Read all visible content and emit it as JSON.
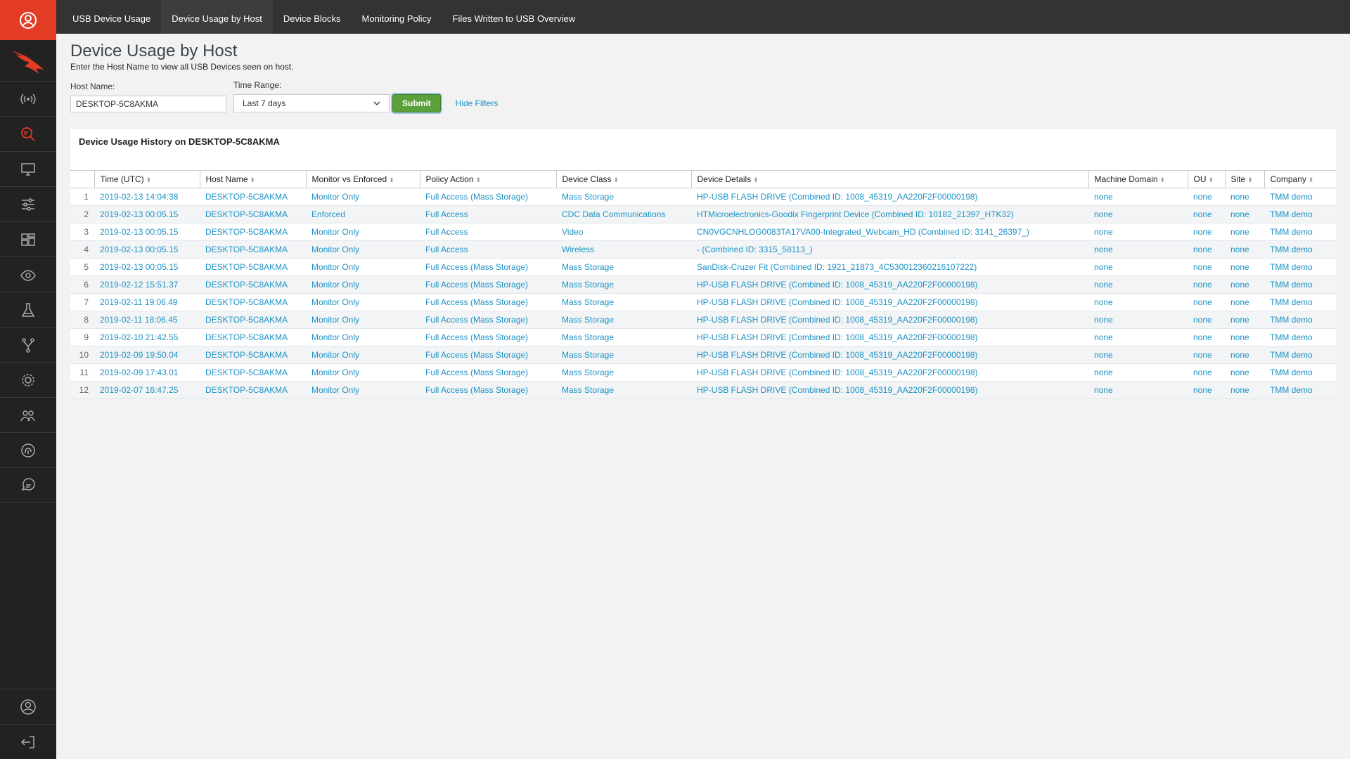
{
  "nav": {
    "tabs": [
      {
        "label": "USB Device Usage"
      },
      {
        "label": "Device Usage by Host"
      },
      {
        "label": "Device Blocks"
      },
      {
        "label": "Monitoring Policy"
      },
      {
        "label": "Files Written to USB Overview"
      }
    ],
    "active_tab": "Device Usage by Host"
  },
  "sidebar": {
    "icons": [
      "user-icon",
      "falcon-logo",
      "broadcast-icon",
      "search-activity-icon",
      "monitor-icon",
      "sliders-icon",
      "dashboard-icon",
      "eye-icon",
      "flask-icon",
      "fork-icon",
      "gear-icon",
      "users-icon",
      "fingerprint-icon",
      "chat-icon",
      "account-icon",
      "logout-icon"
    ],
    "accent": "#e23c24"
  },
  "header": {
    "title": "Device Usage by Host",
    "description": "Enter the Host Name to view all USB Devices seen on host."
  },
  "filters": {
    "host_label": "Host Name:",
    "host_value": "DESKTOP-5C8AKMA",
    "time_label": "Time Range:",
    "time_value": "Last 7 days",
    "submit_label": "Submit",
    "hide_label": "Hide Filters"
  },
  "panel": {
    "title": "Device Usage History on DESKTOP-5C8AKMA"
  },
  "table": {
    "columns": [
      "Time (UTC)",
      "Host Name",
      "Monitor vs Enforced",
      "Policy Action",
      "Device Class",
      "Device Details",
      "Machine Domain",
      "OU",
      "Site",
      "Company"
    ],
    "rows": [
      [
        "1",
        "2019-02-13 14:04:38",
        "DESKTOP-5C8AKMA",
        "Monitor Only",
        "Full Access (Mass Storage)",
        "Mass Storage",
        "HP-USB FLASH DRIVE (Combined ID: 1008_45319_AA220F2F00000198)",
        "none",
        "none",
        "none",
        "TMM demo"
      ],
      [
        "2",
        "2019-02-13 00:05.15",
        "DESKTOP-5C8AKMA",
        "Enforced",
        "Full Access",
        "CDC Data Communications",
        "HTMicroelectronics-Goodix Fingerprint Device (Combined ID: 10182_21397_HTK32)",
        "none",
        "none",
        "none",
        "TMM demo"
      ],
      [
        "3",
        "2019-02-13 00:05.15",
        "DESKTOP-5C8AKMA",
        "Monitor Only",
        "Full Access",
        "Video",
        "CN0VGCNHLOG0083TA17VA00-Integrated_Webcam_HD (Combined ID: 3141_26397_)",
        "none",
        "none",
        "none",
        "TMM demo"
      ],
      [
        "4",
        "2019-02-13 00:05.15",
        "DESKTOP-5C8AKMA",
        "Monitor Only",
        "Full Access",
        "Wireless",
        "- (Combined ID: 3315_58113_)",
        "none",
        "none",
        "none",
        "TMM demo"
      ],
      [
        "5",
        "2019-02-13 00:05.15",
        "DESKTOP-5C8AKMA",
        "Monitor Only",
        "Full Access (Mass Storage)",
        "Mass Storage",
        "SanDisk-Cruzer Fit (Combined ID: 1921_21873_4C530012360216107222)",
        "none",
        "none",
        "none",
        "TMM demo"
      ],
      [
        "6",
        "2019-02-12 15:51.37",
        "DESKTOP-5C8AKMA",
        "Monitor Only",
        "Full Access (Mass Storage)",
        "Mass Storage",
        "HP-USB FLASH DRIVE (Combined ID: 1008_45319_AA220F2F00000198)",
        "none",
        "none",
        "none",
        "TMM demo"
      ],
      [
        "7",
        "2019-02-11 19:06.49",
        "DESKTOP-5C8AKMA",
        "Monitor Only",
        "Full Access (Mass Storage)",
        "Mass Storage",
        "HP-USB FLASH DRIVE (Combined ID: 1008_45319_AA220F2F00000198)",
        "none",
        "none",
        "none",
        "TMM demo"
      ],
      [
        "8",
        "2019-02-11 18:06.45",
        "DESKTOP-5C8AKMA",
        "Monitor Only",
        "Full Access (Mass Storage)",
        "Mass Storage",
        "HP-USB FLASH DRIVE (Combined ID: 1008_45319_AA220F2F00000198)",
        "none",
        "none",
        "none",
        "TMM demo"
      ],
      [
        "9",
        "2019-02-10 21:42.55",
        "DESKTOP-5C8AKMA",
        "Monitor Only",
        "Full Access (Mass Storage)",
        "Mass Storage",
        "HP-USB FLASH DRIVE (Combined ID: 1008_45319_AA220F2F00000198)",
        "none",
        "none",
        "none",
        "TMM demo"
      ],
      [
        "10",
        "2019-02-09 19:50.04",
        "DESKTOP-5C8AKMA",
        "Monitor Only",
        "Full Access (Mass Storage)",
        "Mass Storage",
        "HP-USB FLASH DRIVE (Combined ID: 1008_45319_AA220F2F00000198)",
        "none",
        "none",
        "none",
        "TMM demo"
      ],
      [
        "11",
        "2019-02-09 17:43.01",
        "DESKTOP-5C8AKMA",
        "Monitor Only",
        "Full Access (Mass Storage)",
        "Mass Storage",
        "HP-USB FLASH DRIVE (Combined ID: 1008_45319_AA220F2F00000198)",
        "none",
        "none",
        "none",
        "TMM demo"
      ],
      [
        "12",
        "2019-02-07 16:47.25",
        "DESKTOP-5C8AKMA",
        "Monitor Only",
        "Full Access (Mass Storage)",
        "Mass Storage",
        "HP-USB FLASH DRIVE (Combined ID: 1008_45319_AA220F2F00000198)",
        "none",
        "none",
        "none",
        "TMM demo"
      ]
    ]
  }
}
